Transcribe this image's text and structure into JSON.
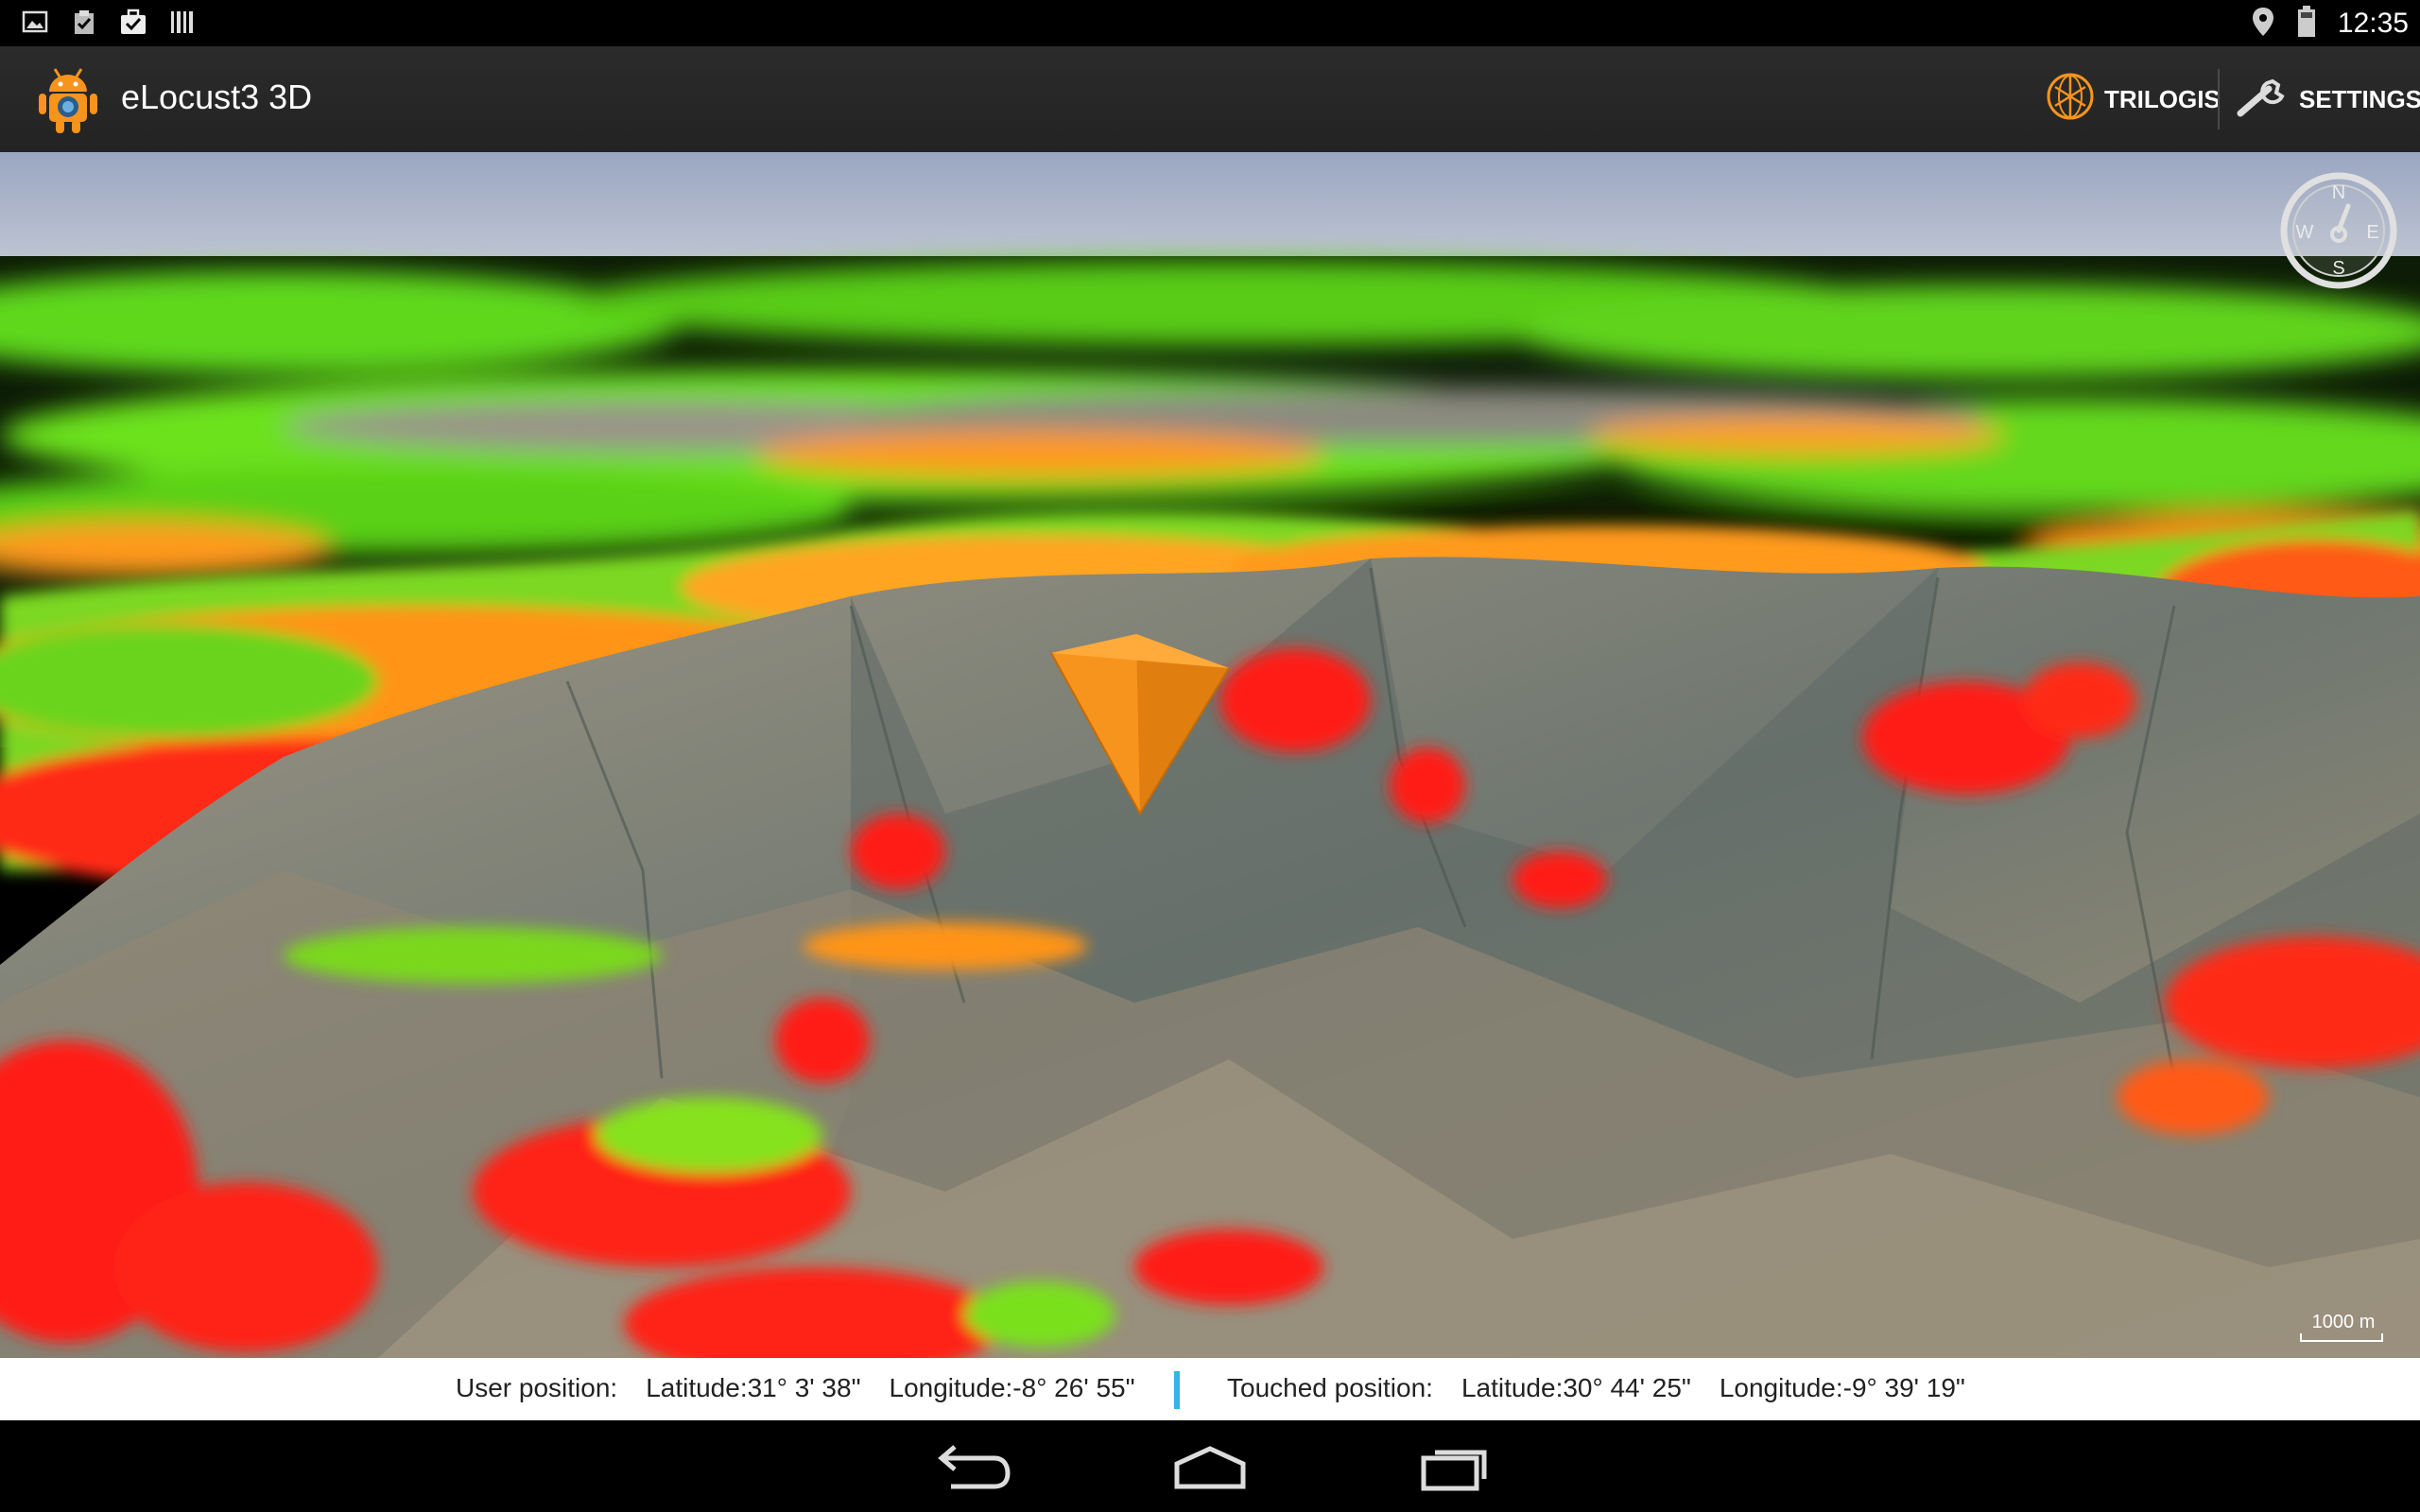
{
  "status_bar": {
    "left_icons": [
      "image-icon",
      "clipboard-check-icon",
      "briefcase-check-icon",
      "barcode-icon"
    ],
    "right_icons": [
      "location-pin-icon",
      "battery-icon"
    ],
    "time": "12:35"
  },
  "action_bar": {
    "app_icon": "android-robot-icon",
    "title": "eLocust3 3D",
    "trilogis_label": "TRILOGIS",
    "settings_label": "SETTINGS"
  },
  "map": {
    "compass": {
      "n": "N",
      "s": "S",
      "e": "E",
      "w": "W"
    },
    "scale_label": "1000 m",
    "colors": {
      "sky": "#a9b3c8",
      "high_risk": "#ff2020",
      "medium_risk": "#ff9a1a",
      "low_risk": "#66e010",
      "dark_vegetation": "#0a1a05",
      "terrain": "#8a8070",
      "marker": "#f7941d"
    }
  },
  "info": {
    "user_label": "User position:",
    "user_lat": "Latitude:31° 3' 38\"",
    "user_lon": "Longitude:-8° 26' 55\"",
    "touched_label": "Touched position:",
    "touched_lat": "Latitude:30° 44' 25\"",
    "touched_lon": "Longitude:-9° 39' 19\""
  },
  "nav_bar": {
    "buttons": [
      "back-icon",
      "home-icon",
      "recent-apps-icon"
    ]
  }
}
